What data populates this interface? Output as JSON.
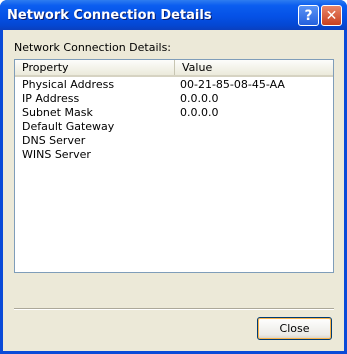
{
  "window": {
    "title": "Network Connection Details",
    "help_glyph": "?",
    "close_glyph": "✕"
  },
  "caption": "Network Connection Details:",
  "list": {
    "columns": [
      "Property",
      "Value"
    ],
    "rows": [
      {
        "property": "Physical Address",
        "value": "00-21-85-08-45-AA"
      },
      {
        "property": "IP Address",
        "value": "0.0.0.0"
      },
      {
        "property": "Subnet Mask",
        "value": "0.0.0.0"
      },
      {
        "property": "Default Gateway",
        "value": ""
      },
      {
        "property": "DNS Server",
        "value": ""
      },
      {
        "property": "WINS Server",
        "value": ""
      }
    ]
  },
  "buttons": {
    "close_label": "Close"
  },
  "colors": {
    "titlebar": "#0551e6",
    "dialog_bg": "#ece9d8",
    "border": "#7f9db9"
  }
}
